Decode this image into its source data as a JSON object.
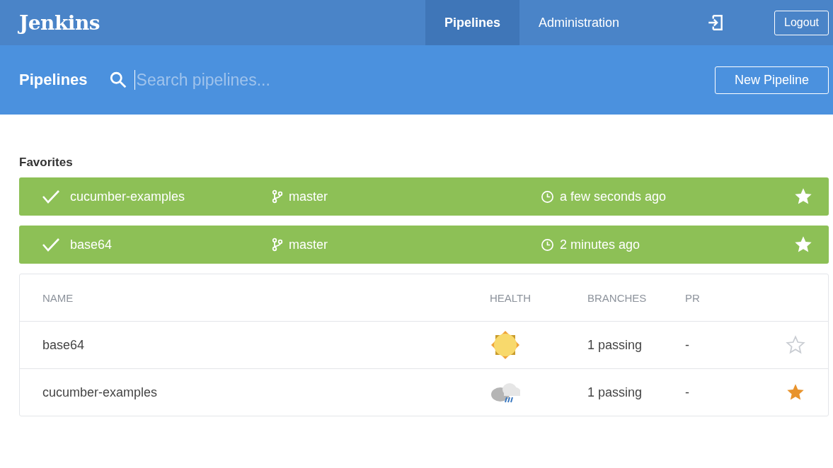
{
  "header": {
    "logo": "Jenkins",
    "nav": [
      {
        "label": "Pipelines",
        "selected": true
      },
      {
        "label": "Administration",
        "selected": false
      }
    ],
    "logout": "Logout"
  },
  "subheader": {
    "title": "Pipelines",
    "search": {
      "placeholder": "Search pipelines..."
    },
    "new_button": "New Pipeline"
  },
  "favorites": {
    "heading": "Favorites",
    "items": [
      {
        "name": "cucumber-examples",
        "branch": "master",
        "time": "a few seconds ago",
        "favorite": true
      },
      {
        "name": "base64",
        "branch": "master",
        "time": "2 minutes ago",
        "favorite": true
      }
    ]
  },
  "table": {
    "columns": [
      "NAME",
      "HEALTH",
      "BRANCHES",
      "PR"
    ],
    "rows": [
      {
        "name": "base64",
        "kind": "sunny",
        "branches": "1 passing",
        "pr": "-",
        "favorite": false
      },
      {
        "name": "cucumber-examples",
        "kind": "rainy",
        "branches": "1 passing",
        "pr": "-",
        "favorite": true
      }
    ]
  }
}
